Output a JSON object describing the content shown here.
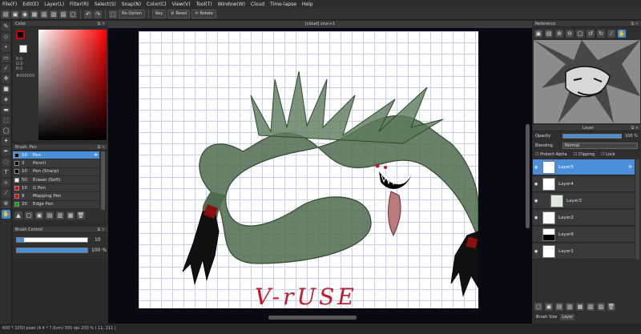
{
  "menu": [
    "File(F)",
    "Edit(E)",
    "Layer(L)",
    "Filter(R)",
    "Select(S)",
    "Snap(N)",
    "Color(C)",
    "View(V)",
    "Tool(T)",
    "Window(W)",
    "Cloud",
    "Time-lapse",
    "Help"
  ],
  "toolbar": {
    "no_option": "No Option",
    "key": "Key",
    "reset": "Reset",
    "rotate": "Rotate"
  },
  "color_panel": {
    "title": "Color",
    "r": "R:0",
    "g": "G:0",
    "b": "B:0",
    "hex": "#000000"
  },
  "brush_panel": {
    "title": "Brush: Pen",
    "items": [
      {
        "size": "10",
        "name": "Pen",
        "color": "#000000",
        "selected": true
      },
      {
        "size": "3",
        "name": "Pencil",
        "color": "#000000"
      },
      {
        "size": "10",
        "name": "Pen (Sharp)",
        "color": "#000000"
      },
      {
        "size": "50",
        "name": "Eraser (Soft)",
        "color": "#ffffff"
      },
      {
        "size": "10",
        "name": "G Pen",
        "color": "#ff0000"
      },
      {
        "size": "8",
        "name": "Mapping Pen",
        "color": "#ff0000"
      },
      {
        "size": "20",
        "name": "Edge Pen",
        "color": "#00aa00"
      }
    ]
  },
  "brush_control": {
    "title": "Brush Control",
    "size": "10",
    "opacity": "100 %",
    "size_fraction": 0.1,
    "opacity_fraction": 1.0
  },
  "canvas": {
    "title": "[cloud] vruc+1",
    "art_text": "V-rUSE"
  },
  "reference": {
    "title": "Reference"
  },
  "layer_panel": {
    "title": "Layer",
    "opacity_label": "Opacity",
    "opacity_value": "100 %",
    "blending_label": "Blending",
    "blending_value": "Normal",
    "protect_alpha": "Protect Alpha",
    "clipping": "Clipping",
    "lock": "Lock",
    "layers": [
      {
        "name": "Layer5",
        "selected": true
      },
      {
        "name": "Layer4"
      },
      {
        "name": "Layer3"
      },
      {
        "name": "Layer2"
      },
      {
        "name": "Layer6"
      },
      {
        "name": "Layer1"
      }
    ],
    "bottom_tabs": [
      "Brush Size",
      "Layer"
    ]
  },
  "status": "600 * 1050 pixel  (4.4 * 7.6cm)  350 dpi  200 %  ( 11, 211 )",
  "colors": {
    "accent": "#4a90d9",
    "monster": "#4f6b4f",
    "red": "#c0182a"
  }
}
